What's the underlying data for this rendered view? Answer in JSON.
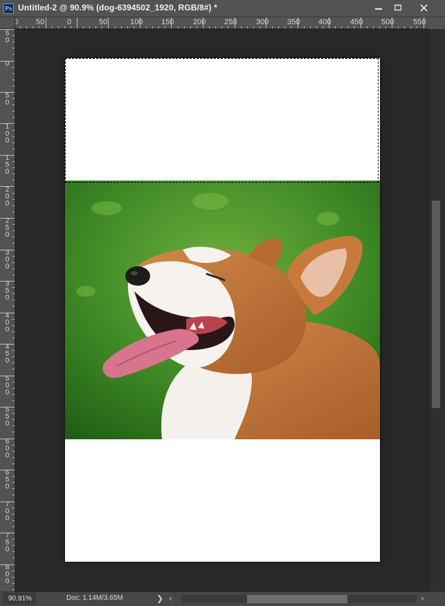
{
  "window": {
    "app_icon": "Ps",
    "title": "Untitled-2 @ 90.9% (dog-6394502_1920, RGB/8#) *",
    "controls": [
      "minimize",
      "restore",
      "close"
    ]
  },
  "ruler_top": {
    "labels": [
      "0",
      "50",
      "0",
      "50",
      "100",
      "150",
      "200",
      "250",
      "300",
      "350",
      "400",
      "450",
      "500",
      "550"
    ]
  },
  "ruler_left": {
    "labels": [
      "50",
      "0",
      "50",
      "100",
      "150",
      "200",
      "250",
      "300",
      "350",
      "400",
      "450",
      "500",
      "550",
      "600",
      "650",
      "700",
      "750",
      "800"
    ]
  },
  "canvas": {
    "document_background": "#ffffff",
    "image_subject": "dog-6394502_1920"
  },
  "status": {
    "zoom": "90.91%",
    "doc_info": "Doc: 1.14M/3.65M",
    "arrow_right": "❯",
    "scroll_left": "‹",
    "scroll_right": "›"
  }
}
